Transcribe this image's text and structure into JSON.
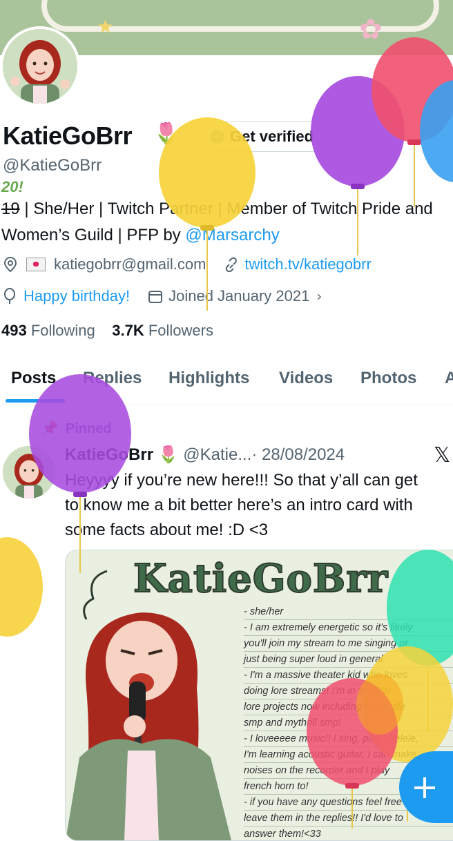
{
  "profile": {
    "display_name": "KatieGoBrr",
    "name_emoji": "🌷",
    "get_verified_label": "Get verified",
    "handle": "@KatieGoBrr",
    "age_scribble": "20!",
    "bio_struck": "19",
    "bio_text": " | She/Her | Twitch Partner | Member of Twitch Pride and Women’s Guild | PFP by ",
    "bio_mention": "@Marsarchy",
    "email": "katiegobrr@gmail.com",
    "website": "twitch.tv/katiegobrr",
    "birthday": "Happy birthday!",
    "joined": "Joined January 2021",
    "following_count": "493",
    "following_label": "Following",
    "followers_count": "3.7K",
    "followers_label": "Followers"
  },
  "tabs": [
    {
      "label": "Posts",
      "active": true
    },
    {
      "label": "Replies",
      "active": false
    },
    {
      "label": "Highlights",
      "active": false
    },
    {
      "label": "Videos",
      "active": false
    },
    {
      "label": "Photos",
      "active": false
    },
    {
      "label": "A",
      "active": false
    }
  ],
  "post": {
    "pinned_label": "Pinned",
    "author": "KatieGoBrr",
    "author_emoji": "🌷",
    "handle": "@Katie...",
    "date": "· 28/08/2024",
    "text": "Heyyyy if you’re new here!!! So that y’all can get\nto know me a bit better here’s an intro card with\nsome facts about me! :D <3",
    "card": {
      "title": "KatieGoBrr",
      "lines": [
        "- she/her",
        "- I am extremely energetic so it's likely",
        "you'll join my stream to me singing or",
        "just being super loud in general",
        "- I'm a massive theater kid who loves",
        "doing lore streams! I'm in several",
        "lore projects now including the oodle",
        "smp and mythrill smp!",
        "- I loveeeee music!! I sing, play ukelele,",
        "I'm learning acoustic guitar, I can make",
        "noises on the recorder and I play",
        "french horn to!",
        "- if you have any questions feel free to",
        "leave them in the replies!! I'd love to",
        "answer them!<33"
      ]
    }
  },
  "fab_label": "+",
  "colors": {
    "accent": "#1d9bf0",
    "text": "#0f1419",
    "muted": "#536471",
    "banner": "#a9c39b"
  },
  "icons": {
    "location": "location-pin-icon",
    "link": "link-icon",
    "birthday": "balloon-icon",
    "calendar": "calendar-icon",
    "pin": "pin-icon",
    "x": "x-logo-icon",
    "compose": "plus-icon"
  }
}
